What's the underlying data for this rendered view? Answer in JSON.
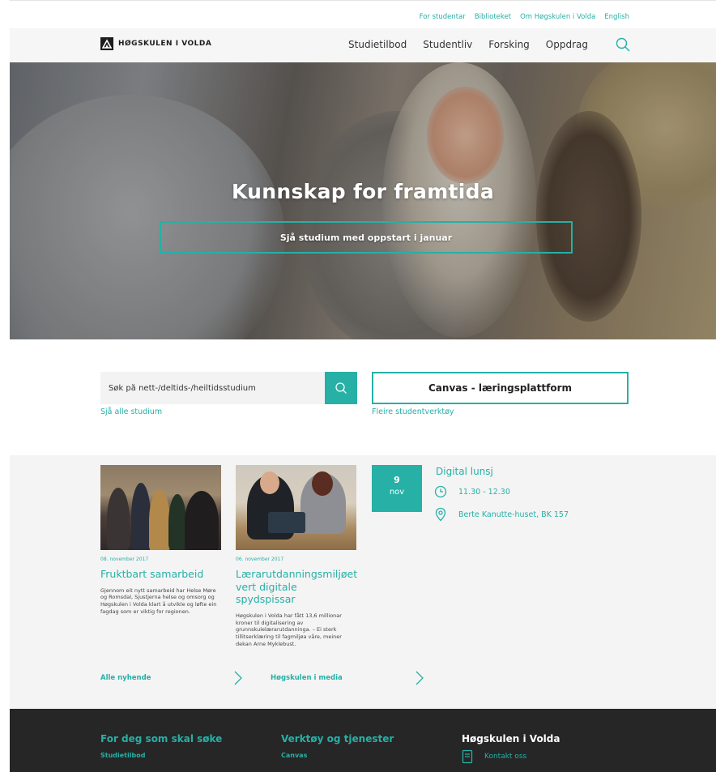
{
  "top_links": [
    "For studentar",
    "Biblioteket",
    "Om Høgskulen i Volda",
    "English"
  ],
  "logo": {
    "text": "HØGSKULEN I VOLDA",
    "icon": "hvo-logo-mark"
  },
  "main_menu": [
    "Studietilbod",
    "Studentliv",
    "Forsking",
    "Oppdrag"
  ],
  "hero": {
    "title": "Kunnskap for framtida",
    "cta": "Sjå studium med oppstart i januar"
  },
  "search": {
    "placeholder": "Søk på nett-/deltids-/heiltidsstudium",
    "icon": "search-icon",
    "all_link": "Sjå alle studium"
  },
  "canvas": {
    "label": "Canvas - læringsplattform",
    "more_link": "Fleire studentverktøy"
  },
  "news": [
    {
      "date": "08. november 2017",
      "title": "Fruktbart samarbeid",
      "text": "Gjennom eit nytt samarbeid har Helse Møre og Romsdal, Sjustjerna helse og omsorg og Høgskulen i Volda klart å utvikle og løfte ein fagdag som er viktig for regionen."
    },
    {
      "date": "06. november 2017",
      "title": "Lærarutdanningsmiljøet vert digitale spydspissar",
      "text": "Høgskulen i Volda har fått 13,6 millionar kroner til digitalisering av grunnskulelærarutdanninga. – Ei sterk tillitserklæring til fagmiljøa våre, meiner dekan Arne Myklebust."
    }
  ],
  "event": {
    "day": "9",
    "month": "nov",
    "title": "Digital lunsj",
    "time": "11.30 - 12.30",
    "place": "Berte Kanutte-huset, BK 157"
  },
  "more_links": {
    "news": "Alle nyhende",
    "media": "Høgskulen i media"
  },
  "footer": {
    "col1": {
      "title": "For deg som skal søke",
      "link": "Studietilbod"
    },
    "col2": {
      "title": "Verktøy og tjenester",
      "link": "Canvas"
    },
    "col3": {
      "title": "Høgskulen i Volda",
      "link": "Kontakt oss"
    }
  },
  "colors": {
    "accent": "#26b0a6",
    "footer_bg": "#262626",
    "section_bg": "#f4f4f4"
  }
}
